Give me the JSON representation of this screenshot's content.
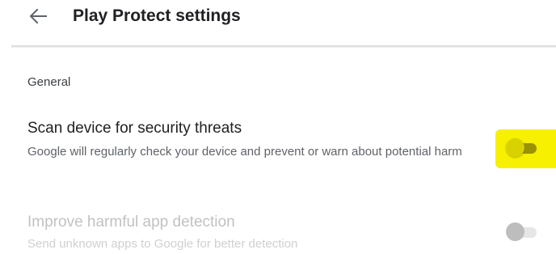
{
  "appbar": {
    "back_icon": "arrow-back-icon",
    "title": "Play Protect settings"
  },
  "section": {
    "header": "General"
  },
  "settings": [
    {
      "title": "Scan device for security threats",
      "subtitle": "Google will regularly check your device and prevent or warn about potential harm",
      "toggle_on": false,
      "enabled": true,
      "highlighted": true
    },
    {
      "title": "Improve harmful app detection",
      "subtitle": "Send unknown apps to Google for better detection",
      "toggle_on": false,
      "enabled": false,
      "highlighted": false
    }
  ],
  "colors": {
    "highlight": "#f7f000",
    "text_primary": "#202124",
    "text_secondary": "#5f6368",
    "text_disabled": "#c2c2c2"
  }
}
